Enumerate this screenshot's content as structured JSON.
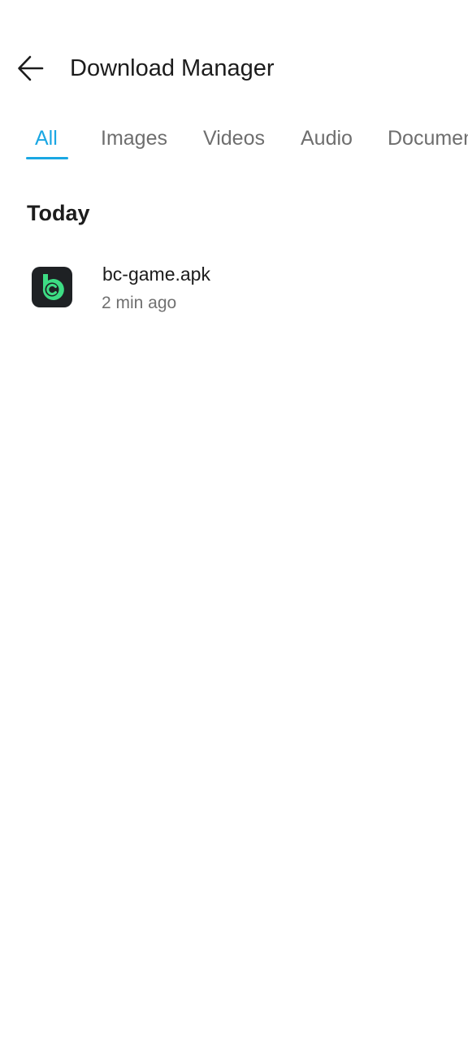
{
  "header": {
    "title": "Download Manager",
    "back_icon": "arrow-left-icon"
  },
  "tabs": [
    {
      "label": "All",
      "active": true
    },
    {
      "label": "Images",
      "active": false
    },
    {
      "label": "Videos",
      "active": false
    },
    {
      "label": "Audio",
      "active": false
    },
    {
      "label": "Documents",
      "active": false
    }
  ],
  "colors": {
    "accent": "#1aa7e3",
    "app_icon_bg": "#1e2124",
    "app_icon_green": "#3ddc84"
  },
  "sections": [
    {
      "title": "Today",
      "items": [
        {
          "name": "bc-game.apk",
          "time": "2 min ago",
          "icon": "bc-game-app-icon"
        }
      ]
    }
  ]
}
